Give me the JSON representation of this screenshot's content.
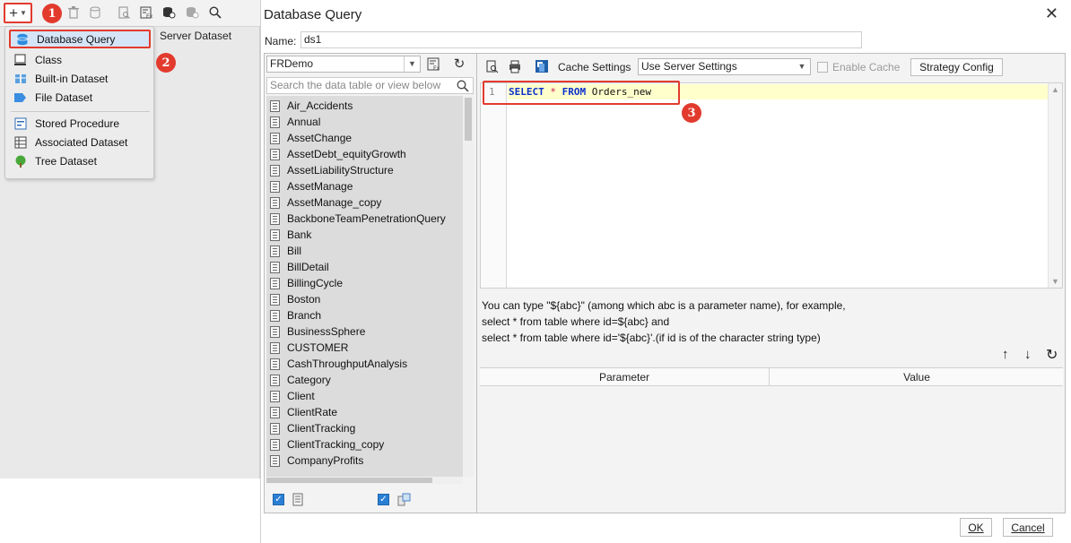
{
  "designer": {
    "tab_label": "Server Dataset",
    "add_menu": {
      "items": [
        {
          "label": "Database Query",
          "icon": "database-icon",
          "selected": true
        },
        {
          "label": "Class",
          "icon": "class-icon"
        },
        {
          "label": "Built-in Dataset",
          "icon": "builtin-dataset-icon"
        },
        {
          "label": "File Dataset",
          "icon": "file-dataset-icon"
        },
        {
          "label": "Stored Procedure",
          "icon": "stored-procedure-icon"
        },
        {
          "label": "Associated Dataset",
          "icon": "associated-dataset-icon"
        },
        {
          "label": "Tree Dataset",
          "icon": "tree-dataset-icon"
        }
      ]
    }
  },
  "annotations": {
    "step1": "1",
    "step2": "2",
    "step3": "3",
    "color": "#e23b2e"
  },
  "dialog": {
    "title": "Database Query",
    "name_label": "Name:",
    "name_value": "ds1",
    "connection": "FRDemo",
    "search_placeholder": "Search the data table or view below",
    "tables": [
      "Air_Accidents",
      "Annual",
      "AssetChange",
      "AssetDebt_equityGrowth",
      "AssetLiabilityStructure",
      "AssetManage",
      "AssetManage_copy",
      "BackboneTeamPenetrationQuery",
      "Bank",
      "Bill",
      "BillDetail",
      "BillingCycle",
      "Boston",
      "Branch",
      "BusinessSphere",
      "CUSTOMER",
      "CashThroughputAnalysis",
      "Category",
      "Client",
      "ClientRate",
      "ClientTracking",
      "ClientTracking_copy",
      "CompanyProfits"
    ],
    "sql_toolbar": {
      "cache_settings_label": "Cache Settings",
      "cache_mode": "Use Server Settings",
      "enable_cache_label": "Enable Cache",
      "strategy_config_label": "Strategy Config"
    },
    "sql": {
      "line_number": "1",
      "kw_select": "SELECT",
      "star": "*",
      "kw_from": "FROM",
      "table": "Orders_new"
    },
    "hint": {
      "line1": "You can type \"${abc}\" (among which abc is a parameter name), for example,",
      "line2": "select * from table where id=${abc} and",
      "line3": "select * from table where id='${abc}'.(if id is of the character string type)"
    },
    "param_table": {
      "col_parameter": "Parameter",
      "col_value": "Value"
    },
    "buttons": {
      "ok": "OK",
      "cancel": "Cancel"
    },
    "accent_color": "#2a7fd4",
    "selection_color": "#d6e4f7"
  }
}
